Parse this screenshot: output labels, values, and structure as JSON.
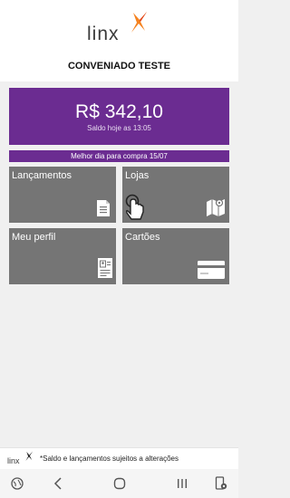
{
  "app": {
    "brand": "linx",
    "user_name": "CONVENIADO TESTE"
  },
  "balance": {
    "value": "R$ 342,10",
    "caption": "Saldo hoje as 13:05"
  },
  "best_day": "Melhor dia para compra 15/07",
  "tiles": {
    "lancamentos": {
      "label": "Lançamentos",
      "icon": "document-icon"
    },
    "lojas": {
      "label": "Lojas",
      "icon": "touch-icon"
    },
    "perfil": {
      "label": "Meu perfil",
      "icon": "profile-card-icon"
    },
    "cartoes": {
      "label": "Cartões",
      "icon": "credit-card-icon"
    }
  },
  "footer": {
    "brand": "linx",
    "note": "*Saldo e lançamentos sujeitos a alterações"
  },
  "colors": {
    "accent_purple": "#6b2c91",
    "tile_gray": "#757575",
    "logo_orange": "#f5821f"
  }
}
